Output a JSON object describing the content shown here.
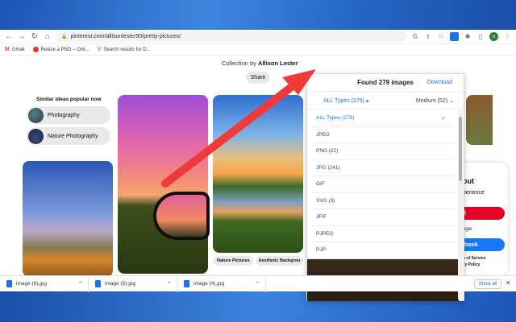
{
  "browser": {
    "url": "pinterest.com/allisonlester90/pretty-pictures/",
    "profile_initial": "n"
  },
  "bookmarks": [
    {
      "label": "Gmail"
    },
    {
      "label": "Resize a PNG – Onli..."
    },
    {
      "label": "Search results for D..."
    }
  ],
  "page": {
    "collection_prefix": "Collection by",
    "collection_owner": "Allison Lester",
    "share_label": "Share",
    "similar_title": "Similar ideas popular now",
    "chips": [
      {
        "label": "Photography"
      },
      {
        "label": "Nature Photography"
      }
    ],
    "tags": [
      "Nature Pictures",
      "Aesthetic Backgrou"
    ],
    "tags_arrow": ">"
  },
  "signup": {
    "title": "out",
    "subtitle": "perience",
    "email_btn": "il",
    "google_btn": "ogle",
    "facebook_btn": "book",
    "terms_line1": "rms of Service",
    "terms_line2": "vacy Policy"
  },
  "popup": {
    "title": "Found 279 images",
    "download_label": "Download",
    "filter_type": "ALL Types (279)",
    "filter_size": "Medium (52)",
    "items": [
      {
        "label": "ALL Types (279)",
        "selected": true
      },
      {
        "label": "JPEG",
        "selected": false
      },
      {
        "label": "PNG (22)",
        "selected": false
      },
      {
        "label": "JPG (241)",
        "selected": false
      },
      {
        "label": "GIF",
        "selected": false
      },
      {
        "label": "SVG (3)",
        "selected": false
      },
      {
        "label": "JFIF",
        "selected": false
      },
      {
        "label": "PJPEG",
        "selected": false
      },
      {
        "label": "PJP",
        "selected": false
      }
    ]
  },
  "downloads": {
    "items": [
      {
        "name": "image (6).jpg"
      },
      {
        "name": "image (5).jpg"
      },
      {
        "name": "image (4).jpg"
      }
    ],
    "show_all": "Show all",
    "close": "✕"
  },
  "colors": {
    "accent": "#1a73e8",
    "annotation_arrow": "#f03a3a"
  }
}
